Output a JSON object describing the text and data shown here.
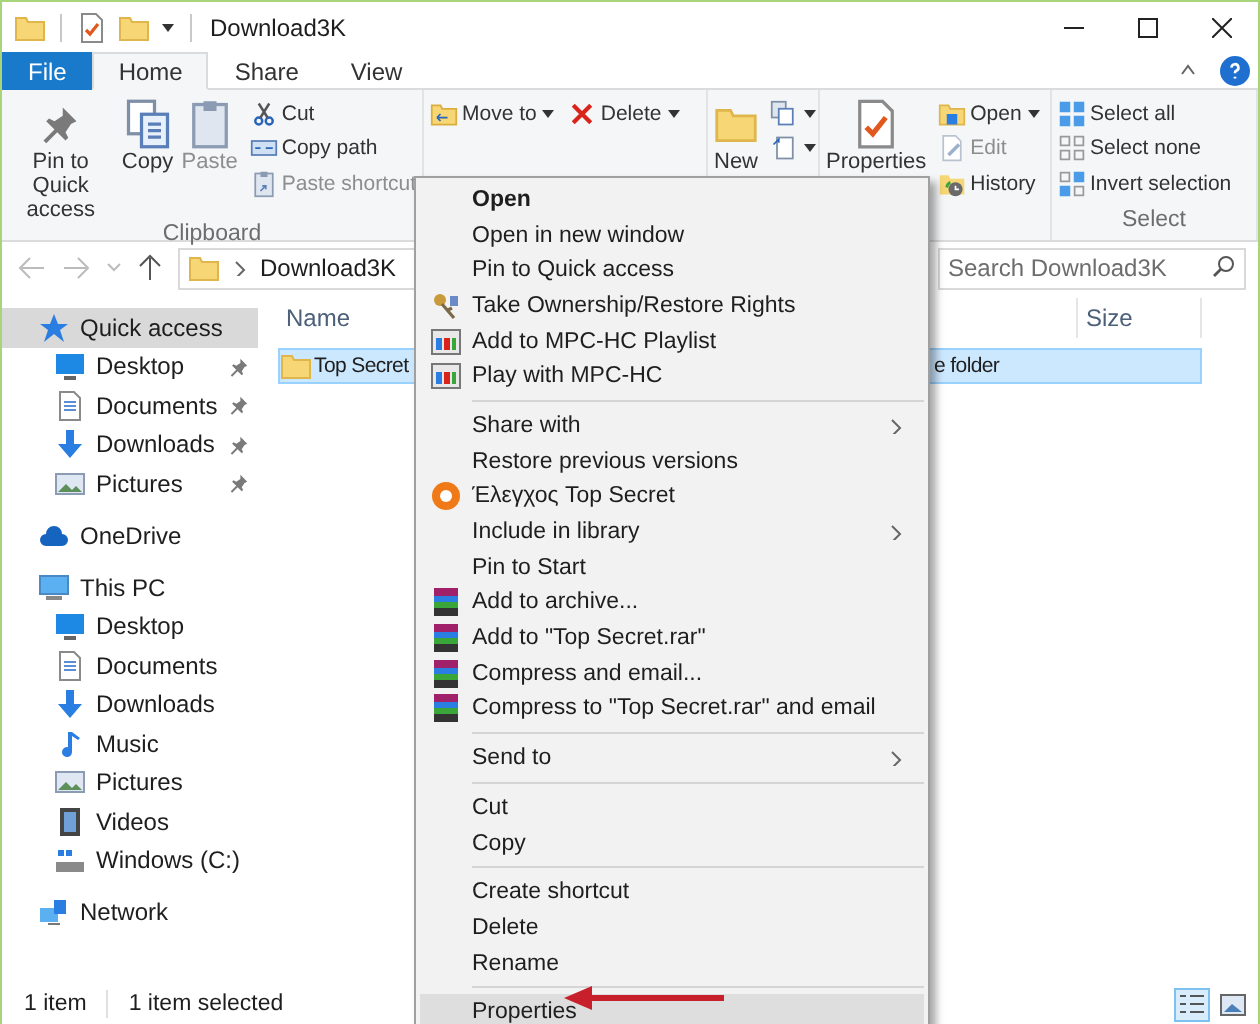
{
  "window": {
    "title": "Download3K"
  },
  "tabs": [
    {
      "label": "File",
      "kind": "file",
      "selected": false
    },
    {
      "label": "Home",
      "kind": "tab",
      "selected": true
    },
    {
      "label": "Share",
      "kind": "tab",
      "selected": false
    },
    {
      "label": "View",
      "kind": "tab",
      "selected": false
    }
  ],
  "ribbon": {
    "groups": [
      {
        "label": "Clipboard",
        "columns": [
          {
            "kind": "large",
            "buttons": [
              {
                "label": "Pin to Quick access",
                "disabled": false,
                "dropdown": false
              },
              {
                "label": "Copy",
                "disabled": false,
                "dropdown": false
              },
              {
                "label": "Paste",
                "disabled": true,
                "dropdown": false
              }
            ]
          },
          {
            "kind": "small",
            "buttons": [
              {
                "label": "Cut",
                "disabled": false,
                "dropdown": false
              },
              {
                "label": "Copy path",
                "disabled": false,
                "dropdown": false
              },
              {
                "label": "Paste shortcut",
                "disabled": true,
                "dropdown": false
              }
            ]
          }
        ]
      },
      {
        "columns": [
          {
            "kind": "small",
            "buttons": [
              {
                "label": "Move to",
                "disabled": false,
                "dropdown": true
              }
            ]
          },
          {
            "kind": "small",
            "buttons": [
              {
                "label": "Delete",
                "disabled": false,
                "dropdown": true
              }
            ]
          }
        ]
      },
      {
        "columns": [
          {
            "kind": "large",
            "buttons": [
              {
                "label": "New",
                "disabled": false
              }
            ]
          },
          {
            "kind": "small",
            "buttons": [
              {
                "dropdown": true
              },
              {
                "dropdown": true
              }
            ]
          }
        ]
      },
      {
        "columns": [
          {
            "kind": "large",
            "buttons": [
              {
                "label": "Properties",
                "disabled": false
              }
            ]
          },
          {
            "kind": "small",
            "buttons": [
              {
                "label": "Open",
                "disabled": false,
                "dropdown": true
              },
              {
                "label": "Edit",
                "disabled": true,
                "dropdown": false
              },
              {
                "label": "History",
                "disabled": false,
                "dropdown": false
              }
            ]
          }
        ]
      },
      {
        "label": "Select",
        "columns": [
          {
            "kind": "small",
            "buttons": [
              {
                "label": "Select all",
                "disabled": false,
                "dropdown": false
              },
              {
                "label": "Select none",
                "disabled": false,
                "dropdown": false
              },
              {
                "label": "Invert selection",
                "disabled": false,
                "dropdown": false
              }
            ]
          }
        ]
      }
    ]
  },
  "address": {
    "path": "Download3K"
  },
  "search": {
    "placeholder": "Search Download3K"
  },
  "navigation": [
    {
      "label": "Quick access",
      "selected": true,
      "pinned": false,
      "children": [
        {
          "label": "Desktop",
          "selected": false,
          "pinned": true
        },
        {
          "label": "Documents",
          "selected": false,
          "pinned": true
        },
        {
          "label": "Downloads",
          "selected": false,
          "pinned": true
        },
        {
          "label": "Pictures",
          "selected": false,
          "pinned": true
        }
      ]
    },
    {
      "label": "OneDrive",
      "selected": false,
      "pinned": false
    },
    {
      "label": "This PC",
      "selected": false,
      "pinned": false,
      "children": [
        {
          "label": "Desktop",
          "selected": false,
          "pinned": false
        },
        {
          "label": "Documents",
          "selected": false,
          "pinned": false
        },
        {
          "label": "Downloads",
          "selected": false,
          "pinned": false
        },
        {
          "label": "Music",
          "selected": false,
          "pinned": false
        },
        {
          "label": "Pictures",
          "selected": false,
          "pinned": false
        },
        {
          "label": "Videos",
          "selected": false,
          "pinned": false
        },
        {
          "label": "Windows (C:)",
          "selected": false,
          "pinned": false
        }
      ]
    },
    {
      "label": "Network",
      "selected": false,
      "pinned": false
    }
  ],
  "columns": [
    "Name",
    "Size"
  ],
  "files": [
    {
      "name": "Top Secret",
      "type": "e folder",
      "selected": true
    }
  ],
  "context_menu": [
    {
      "kind": "item",
      "label": "Open",
      "default": true,
      "submenu": false,
      "highlighted": false
    },
    {
      "kind": "item",
      "label": "Open in new window",
      "default": false,
      "submenu": false,
      "highlighted": false
    },
    {
      "kind": "item",
      "label": "Pin to Quick access",
      "default": false,
      "submenu": false,
      "highlighted": false
    },
    {
      "kind": "item",
      "label": "Take Ownership/Restore Rights",
      "default": false,
      "submenu": false,
      "highlighted": false
    },
    {
      "kind": "item",
      "label": "Add to MPC-HC Playlist",
      "default": false,
      "submenu": false,
      "highlighted": false
    },
    {
      "kind": "item",
      "label": "Play with MPC-HC",
      "default": false,
      "submenu": false,
      "highlighted": false
    },
    {
      "kind": "separator"
    },
    {
      "kind": "item",
      "label": "Share with",
      "default": false,
      "submenu": true,
      "highlighted": false
    },
    {
      "kind": "item",
      "label": "Restore previous versions",
      "default": false,
      "submenu": false,
      "highlighted": false
    },
    {
      "kind": "item",
      "label": "Έλεγχος Top Secret",
      "default": false,
      "submenu": false,
      "highlighted": false
    },
    {
      "kind": "item",
      "label": "Include in library",
      "default": false,
      "submenu": true,
      "highlighted": false
    },
    {
      "kind": "item",
      "label": "Pin to Start",
      "default": false,
      "submenu": false,
      "highlighted": false
    },
    {
      "kind": "item",
      "label": "Add to archive...",
      "default": false,
      "submenu": false,
      "highlighted": false
    },
    {
      "kind": "item",
      "label": "Add to \"Top Secret.rar\"",
      "default": false,
      "submenu": false,
      "highlighted": false
    },
    {
      "kind": "item",
      "label": "Compress and email...",
      "default": false,
      "submenu": false,
      "highlighted": false
    },
    {
      "kind": "item",
      "label": "Compress to \"Top Secret.rar\" and email",
      "default": false,
      "submenu": false,
      "highlighted": false
    },
    {
      "kind": "separator"
    },
    {
      "kind": "item",
      "label": "Send to",
      "default": false,
      "submenu": true,
      "highlighted": false
    },
    {
      "kind": "separator"
    },
    {
      "kind": "item",
      "label": "Cut",
      "default": false,
      "submenu": false,
      "highlighted": false
    },
    {
      "kind": "item",
      "label": "Copy",
      "default": false,
      "submenu": false,
      "highlighted": false
    },
    {
      "kind": "separator"
    },
    {
      "kind": "item",
      "label": "Create shortcut",
      "default": false,
      "submenu": false,
      "highlighted": false
    },
    {
      "kind": "item",
      "label": "Delete",
      "default": false,
      "submenu": false,
      "highlighted": false
    },
    {
      "kind": "item",
      "label": "Rename",
      "default": false,
      "submenu": false,
      "highlighted": false
    },
    {
      "kind": "separator"
    },
    {
      "kind": "item",
      "label": "Properties",
      "default": false,
      "submenu": false,
      "highlighted": true
    }
  ],
  "status_bar": {
    "items": "1 item",
    "selection": "1 item selected"
  },
  "view_buttons": [
    {
      "kind": "details",
      "selected": true
    },
    {
      "kind": "large_icons",
      "selected": false
    }
  ]
}
